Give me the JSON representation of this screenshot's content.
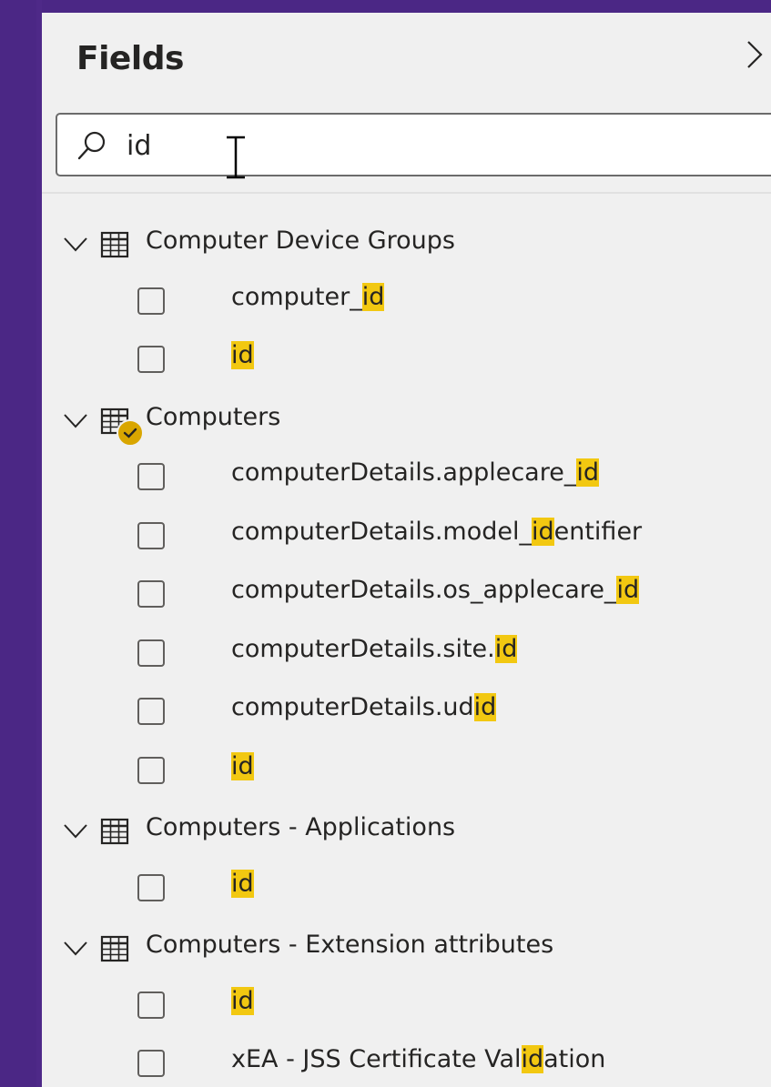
{
  "panel": {
    "title": "Fields",
    "collapse_icon": "chevron-right-icon"
  },
  "search": {
    "value": "id",
    "icon": "search-icon"
  },
  "highlight_color": "#f2c811",
  "tree": [
    {
      "type": "table",
      "label": "Computer Device Groups",
      "expanded": true,
      "has_check_badge": false,
      "fields": [
        {
          "pre": "computer_",
          "hit": "id",
          "post": ""
        },
        {
          "pre": "",
          "hit": "id",
          "post": ""
        }
      ]
    },
    {
      "type": "table",
      "label": "Computers",
      "expanded": true,
      "has_check_badge": true,
      "fields": [
        {
          "pre": "computerDetails.applecare_",
          "hit": "id",
          "post": ""
        },
        {
          "pre": "computerDetails.model_",
          "hit": "id",
          "post": "entifier"
        },
        {
          "pre": "computerDetails.os_applecare_",
          "hit": "id",
          "post": ""
        },
        {
          "pre": "computerDetails.site.",
          "hit": "id",
          "post": ""
        },
        {
          "pre": "computerDetails.ud",
          "hit": "id",
          "post": ""
        },
        {
          "pre": "",
          "hit": "id",
          "post": ""
        }
      ]
    },
    {
      "type": "table",
      "label": "Computers - Applications",
      "expanded": true,
      "has_check_badge": false,
      "fields": [
        {
          "pre": "",
          "hit": "id",
          "post": ""
        }
      ]
    },
    {
      "type": "table",
      "label": "Computers - Extension attributes",
      "expanded": true,
      "has_check_badge": false,
      "fields": [
        {
          "pre": "",
          "hit": "id",
          "post": ""
        },
        {
          "pre": "xEA - JSS Certificate Val",
          "hit": "id",
          "post": "ation"
        }
      ]
    }
  ]
}
